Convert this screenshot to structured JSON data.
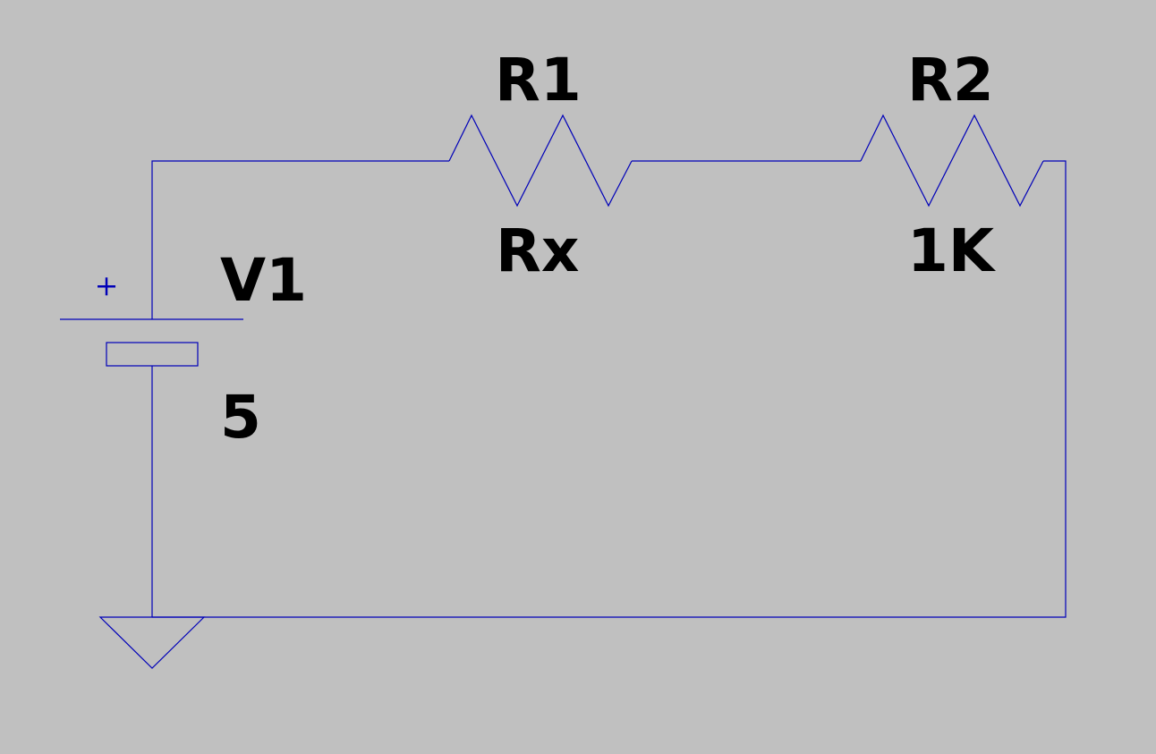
{
  "colors": {
    "background": "#c0c0c0",
    "wire": "#0000b8",
    "text": "#000000"
  },
  "components": {
    "v1": {
      "name": "V1",
      "value": "5",
      "polarity_mark": "+"
    },
    "r1": {
      "name": "R1",
      "value": "Rx"
    },
    "r2": {
      "name": "R2",
      "value": "1K"
    }
  },
  "ground": {
    "icon": "ground-icon"
  }
}
